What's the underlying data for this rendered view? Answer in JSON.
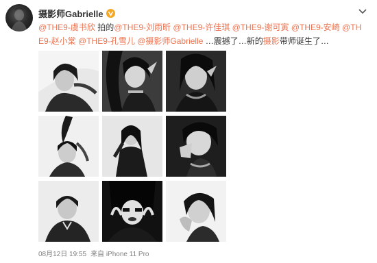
{
  "user": {
    "name": "摄影师Gabrielle",
    "badge": "verified-v-badge"
  },
  "post": {
    "segments": [
      {
        "type": "mention",
        "text": "@THE9-虞书欣"
      },
      {
        "type": "plain",
        "text": " 拍的"
      },
      {
        "type": "mention",
        "text": "@THE9-刘雨昕"
      },
      {
        "type": "plain",
        "text": " "
      },
      {
        "type": "mention",
        "text": "@THE9-许佳琪"
      },
      {
        "type": "plain",
        "text": " "
      },
      {
        "type": "mention",
        "text": "@THE9-谢可寅"
      },
      {
        "type": "plain",
        "text": " "
      },
      {
        "type": "mention",
        "text": "@THE9-安崎"
      },
      {
        "type": "plain",
        "text": " "
      },
      {
        "type": "mention",
        "text": "@THE9-赵小棠"
      },
      {
        "type": "plain",
        "text": " "
      },
      {
        "type": "mention",
        "text": "@THE9-孔雪儿"
      },
      {
        "type": "plain",
        "text": " "
      },
      {
        "type": "mention",
        "text": "@摄影师Gabrielle"
      },
      {
        "type": "plain",
        "text": " …震撼了…新的"
      },
      {
        "type": "mention",
        "text": "摄影"
      },
      {
        "type": "plain",
        "text": "带师诞生了…"
      }
    ]
  },
  "photos": [
    {
      "label": "photo-1"
    },
    {
      "label": "photo-2"
    },
    {
      "label": "photo-3"
    },
    {
      "label": "photo-4"
    },
    {
      "label": "photo-5"
    },
    {
      "label": "photo-6"
    },
    {
      "label": "photo-7"
    },
    {
      "label": "photo-8"
    },
    {
      "label": "photo-9"
    }
  ],
  "meta": {
    "date": "08月12日 19:55",
    "source": "来自 iPhone 11 Pro"
  },
  "colors": {
    "mention": "#eb7350",
    "text": "#333333",
    "meta": "#808080",
    "badge": "#f5a623"
  },
  "icons": {
    "dropdown": "chevron-down-icon"
  }
}
